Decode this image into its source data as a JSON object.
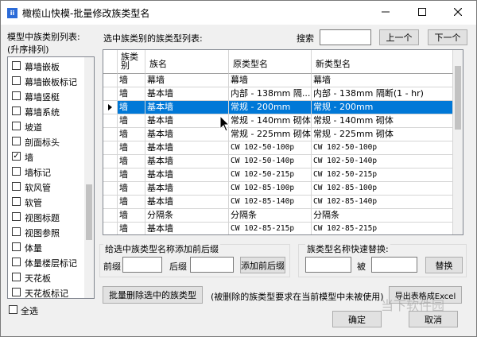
{
  "window": {
    "title": "橄榄山快模-批量修改族类型名",
    "app_icon": "ii"
  },
  "left_panel": {
    "title": "模型中族类别列表:",
    "subtitle": "(升序排列)",
    "categories": [
      {
        "label": "幕墙嵌板",
        "checked": false
      },
      {
        "label": "幕墙嵌板标记",
        "checked": false
      },
      {
        "label": "幕墙竖梃",
        "checked": false
      },
      {
        "label": "幕墙系统",
        "checked": false
      },
      {
        "label": "坡道",
        "checked": false
      },
      {
        "label": "剖面标头",
        "checked": false
      },
      {
        "label": "墙",
        "checked": true
      },
      {
        "label": "墙标记",
        "checked": false
      },
      {
        "label": "软风管",
        "checked": false
      },
      {
        "label": "软管",
        "checked": false
      },
      {
        "label": "视图标题",
        "checked": false
      },
      {
        "label": "视图参照",
        "checked": false
      },
      {
        "label": "体量",
        "checked": false
      },
      {
        "label": "体量楼层标记",
        "checked": false
      },
      {
        "label": "天花板",
        "checked": false
      },
      {
        "label": "天花板标记",
        "checked": false
      }
    ],
    "select_all": "全选"
  },
  "top": {
    "list_label": "选中族类别的族类型列表:",
    "search_label": "搜索",
    "search_value": "",
    "prev_button": "上一个",
    "next_button": "下一个"
  },
  "grid": {
    "headers": {
      "category": "族类别",
      "family": "族名",
      "old": "原类型名",
      "new": "新类型名"
    },
    "selected_row": 2,
    "rows": [
      {
        "category": "墙",
        "family": "幕墙",
        "old": "幕墙",
        "new": "幕墙"
      },
      {
        "category": "墙",
        "family": "基本墙",
        "old": "内部 - 138mm 隔...",
        "new": "内部 - 138mm 隔断(1 - hr)"
      },
      {
        "category": "墙",
        "family": "基本墙",
        "old": "常规 - 200mm",
        "new": "常规 - 200mm"
      },
      {
        "category": "墙",
        "family": "基本墙",
        "old": "常规 - 140mm 砌体",
        "new": "常规 - 140mm 砌体"
      },
      {
        "category": "墙",
        "family": "基本墙",
        "old": "常规 - 225mm 砌体",
        "new": "常规 - 225mm 砌体"
      },
      {
        "category": "墙",
        "family": "基本墙",
        "old": "CW 102-50-100p",
        "new": "CW 102-50-100p"
      },
      {
        "category": "墙",
        "family": "基本墙",
        "old": "CW 102-50-140p",
        "new": "CW 102-50-140p"
      },
      {
        "category": "墙",
        "family": "基本墙",
        "old": "CW 102-50-215p",
        "new": "CW 102-50-215p"
      },
      {
        "category": "墙",
        "family": "基本墙",
        "old": "CW 102-85-100p",
        "new": "CW 102-85-100p"
      },
      {
        "category": "墙",
        "family": "基本墙",
        "old": "CW 102-85-140p",
        "new": "CW 102-85-140p"
      },
      {
        "category": "墙",
        "family": "分隔条",
        "old": "分隔条",
        "new": "分隔条"
      },
      {
        "category": "墙",
        "family": "基本墙",
        "old": "CW 102-85-215p",
        "new": "CW 102-85-215p"
      }
    ]
  },
  "prefix_suffix": {
    "title": "给选中族类型名称添加前后缀",
    "prefix_label": "前缀",
    "prefix_value": "",
    "suffix_label": "后缀",
    "suffix_value": "",
    "add_button": "添加前后缀"
  },
  "replace": {
    "title": "族类型名称快速替换:",
    "find_value": "",
    "by_label": "被",
    "replace_value": "",
    "replace_button": "替换"
  },
  "bottom": {
    "batch_delete_button": "批量删除选中的族类型",
    "note": "(被删除的族类型要求在当前模型中未被使用)",
    "export_button": "导出表格成Excel",
    "ok_button": "确定",
    "cancel_button": "取消",
    "watermark": "当下软件园"
  },
  "colors": {
    "selection": "#0078d7",
    "selection_text": "#ffffff",
    "watermark": "#c8c8c8"
  },
  "icons": {
    "minimize": "minimize-icon",
    "maximize": "maximize-icon",
    "close": "close-icon",
    "row_pointer": "triangle-right-icon",
    "cursor": "mouse-cursor-icon"
  }
}
